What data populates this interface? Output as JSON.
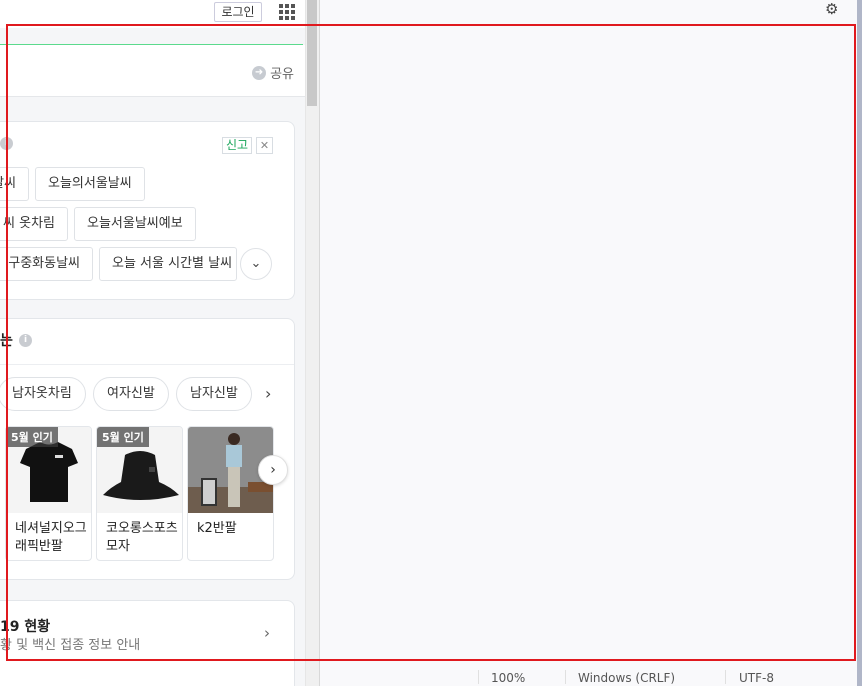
{
  "topbar": {
    "login_label": "로그인"
  },
  "header": {
    "share_label": "공유"
  },
  "related": {
    "report_label": "신고",
    "close_label": "✕",
    "chips": [
      {
        "label": "날씨"
      },
      {
        "label": "오늘의서울날씨"
      },
      {
        "label": "씨 옷차림"
      },
      {
        "label": "오늘서울날씨예보"
      },
      {
        "label": "구중화동날씨"
      },
      {
        "label": "오늘 서울 시간별 날씨"
      }
    ]
  },
  "shopping": {
    "title_fragment": "는",
    "pills": [
      {
        "label": "남자옷차림"
      },
      {
        "label": "여자신발"
      },
      {
        "label": "남자신발"
      }
    ],
    "products": [
      {
        "badge": "5월 인기",
        "name": "네셔널지오그래픽반팔"
      },
      {
        "badge": "5월 인기",
        "name": "코오롱스포츠모자"
      },
      {
        "badge": "",
        "name": "k2반팔"
      }
    ]
  },
  "covid": {
    "title": "19 현황",
    "subtitle": "황 및 백신 접종 정보 안내"
  },
  "status_bar": {
    "zoom": "100%",
    "line_ending": "Windows (CRLF)",
    "encoding": "UTF-8"
  },
  "colors": {
    "accent_green": "#19ce60",
    "highlight_frame": "#e0191e"
  }
}
